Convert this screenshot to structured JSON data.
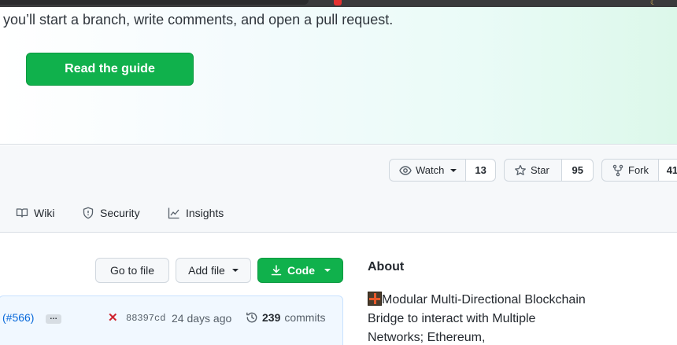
{
  "hero": {
    "text": "you’ll start a branch, write comments, and open a pull request.",
    "button_label": "Read the guide"
  },
  "social": {
    "watch_label": "Watch",
    "watch_count": "13",
    "star_label": "Star",
    "star_count": "95",
    "fork_label": "Fork",
    "fork_count": "41"
  },
  "nav": {
    "items": [
      {
        "label": "Wiki",
        "icon": "book-icon"
      },
      {
        "label": "Security",
        "icon": "shield-icon"
      },
      {
        "label": "Insights",
        "icon": "graph-icon"
      }
    ]
  },
  "toolbar": {
    "go_to_file": "Go to file",
    "add_file": "Add file",
    "code": "Code"
  },
  "commit": {
    "pr_link": "(#566)",
    "ellipsis": "…",
    "status_icon": "x-icon",
    "status_color": "#cf222e",
    "sha": "88397cd",
    "ago": "24 days ago",
    "count": "239",
    "count_label": "commits"
  },
  "about": {
    "title": "About",
    "description": "Modular Multi-Directional Blockchain Bridge to interact with Multiple Networks; Ethereum,"
  },
  "colors": {
    "accent_green": "#10b14c",
    "link_blue": "#0969da"
  }
}
